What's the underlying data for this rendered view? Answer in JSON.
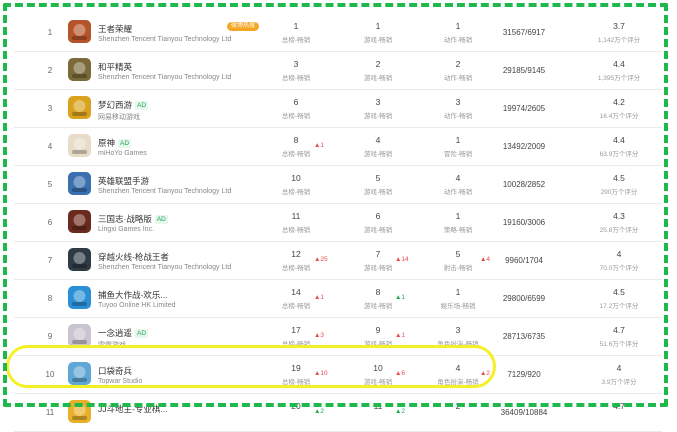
{
  "colors": {
    "frame": "#1fb84a",
    "highlight": "#f5f026",
    "ad_badge": "#21a45a",
    "promo_badge": "#f5a623",
    "rank_up": "#e8494a",
    "rank_up_green": "#22a658"
  },
  "rows": [
    {
      "rank": "1",
      "name": "王者荣耀",
      "ad": "",
      "promo": "微博热搜",
      "dev": "Shenzhen Tencent Tianyou Technology Ltd",
      "icon": "honor-of-kings-icon",
      "icon_bg": "#b5542a",
      "r1": "1",
      "l1": "总榜-畅销",
      "ch1": "",
      "r2": "1",
      "l2": "游戏-畅销",
      "ch2": "",
      "r3": "1",
      "l3": "动作-畅销",
      "ch3": "",
      "rating": "31567/6917",
      "score": "3.7",
      "count": "1,142万个评分"
    },
    {
      "rank": "2",
      "name": "和平精英",
      "ad": "",
      "promo": "",
      "dev": "Shenzhen Tencent Tianyou Technology Ltd",
      "icon": "peacekeeper-elite-icon",
      "icon_bg": "#7a6a3a",
      "r1": "3",
      "l1": "总榜-畅销",
      "ch1": "",
      "r2": "2",
      "l2": "游戏-畅销",
      "ch2": "",
      "r3": "2",
      "l3": "动作-畅销",
      "ch3": "",
      "rating": "29185/9145",
      "score": "4.4",
      "count": "1,395万个评分"
    },
    {
      "rank": "3",
      "name": "梦幻西游",
      "ad": "AD",
      "promo": "",
      "dev": "网易移动游戏",
      "icon": "fantasy-westward-icon",
      "icon_bg": "#d9a21e",
      "r1": "6",
      "l1": "总榜-畅销",
      "ch1": "",
      "r2": "3",
      "l2": "游戏-畅销",
      "ch2": "",
      "r3": "3",
      "l3": "动作-畅销",
      "ch3": "",
      "rating": "19974/2605",
      "score": "4.2",
      "count": "16.4万个评分"
    },
    {
      "rank": "4",
      "name": "原神",
      "ad": "AD",
      "promo": "",
      "dev": "miHoYo Games",
      "icon": "genshin-icon",
      "icon_bg": "#e8dcc8",
      "r1": "8",
      "l1": "总榜-畅销",
      "ch1": "▲1",
      "r2": "4",
      "l2": "游戏-畅销",
      "ch2": "",
      "r3": "1",
      "l3": "冒险-畅销",
      "ch3": "",
      "rating": "13492/2009",
      "score": "4.4",
      "count": "63.9万个评分"
    },
    {
      "rank": "5",
      "name": "英雄联盟手游",
      "ad": "",
      "promo": "",
      "dev": "Shenzhen Tencent Tianyou Technology Ltd",
      "icon": "league-legends-icon",
      "icon_bg": "#3a6fb0",
      "r1": "10",
      "l1": "总榜-畅销",
      "ch1": "",
      "r2": "5",
      "l2": "游戏-畅销",
      "ch2": "",
      "r3": "4",
      "l3": "动作-畅销",
      "ch3": "",
      "rating": "10028/2852",
      "score": "4.5",
      "count": "290万个评分"
    },
    {
      "rank": "6",
      "name": "三国志·战略版",
      "ad": "AD",
      "promo": "",
      "dev": "Lingxi Games Inc.",
      "icon": "three-kingdoms-icon",
      "icon_bg": "#6b2a1e",
      "r1": "11",
      "l1": "总榜-畅销",
      "ch1": "",
      "r2": "6",
      "l2": "游戏-畅销",
      "ch2": "",
      "r3": "1",
      "l3": "策略-畅销",
      "ch3": "",
      "rating": "19160/3006",
      "score": "4.3",
      "count": "25.8万个评分"
    },
    {
      "rank": "7",
      "name": "穿越火线-枪战王者",
      "ad": "",
      "promo": "",
      "dev": "Shenzhen Tencent Tianyou Technology Ltd",
      "icon": "crossfire-icon",
      "icon_bg": "#2e3a44",
      "r1": "12",
      "l1": "总榜-畅销",
      "ch1": "▲25",
      "r2": "7",
      "l2": "游戏-畅销",
      "ch2": "▲14",
      "r3": "5",
      "l3": "射击-畅销",
      "ch3": "▲4",
      "rating": "9960/1704",
      "score": "4",
      "count": "70.0万个评分"
    },
    {
      "rank": "8",
      "name": "捕鱼大作战-欢乐...",
      "ad": "",
      "promo": "",
      "dev": "Tuyoo Online HK Limited",
      "icon": "fishing-icon",
      "icon_bg": "#2a8fd6",
      "r1": "14",
      "l1": "总榜-畅销",
      "ch1": "▲1",
      "r2": "8",
      "l2": "游戏-畅销",
      "ch2": "▲1",
      "ch2c": "green",
      "r3": "1",
      "l3": "娱乐场-畅销",
      "ch3": "",
      "rating": "29800/6599",
      "score": "4.5",
      "count": "17.2万个评分"
    },
    {
      "rank": "9",
      "name": "一念逍遥",
      "ad": "AD",
      "promo": "",
      "dev": "雷霆游戏",
      "icon": "yinian-icon",
      "icon_bg": "#c9c4cf",
      "r1": "17",
      "l1": "总榜-畅销",
      "ch1": "▲3",
      "r2": "9",
      "l2": "游戏-畅销",
      "ch2": "▲1",
      "r3": "3",
      "l3": "角色扮演-畅销",
      "ch3": "",
      "rating": "28713/6735",
      "score": "4.7",
      "count": "51.6万个评分"
    },
    {
      "rank": "10",
      "name": "口袋奇兵",
      "ad": "",
      "promo": "",
      "dev": "Topwar Studio",
      "icon": "topwar-icon",
      "icon_bg": "#5fa8d6",
      "r1": "19",
      "l1": "总榜-畅销",
      "ch1": "▲10",
      "r2": "10",
      "l2": "游戏-畅销",
      "ch2": "▲6",
      "r3": "4",
      "l3": "角色扮演-畅销",
      "ch3": "▲2",
      "rating": "7129/920",
      "score": "4",
      "count": "3.9万个评分"
    },
    {
      "rank": "11",
      "name": "JJ斗地主-专业棋...",
      "ad": "",
      "promo": "",
      "dev": "",
      "icon": "jj-poker-icon",
      "icon_bg": "#e8b02a",
      "r1": "20",
      "l1": "",
      "ch1": "▲2",
      "ch1c": "green",
      "r2": "11",
      "l2": "",
      "ch2": "▲2",
      "ch2c": "green",
      "r3": "2",
      "l3": "",
      "ch3": "",
      "rating": "36409/10884",
      "score": "4.7",
      "count": ""
    }
  ]
}
